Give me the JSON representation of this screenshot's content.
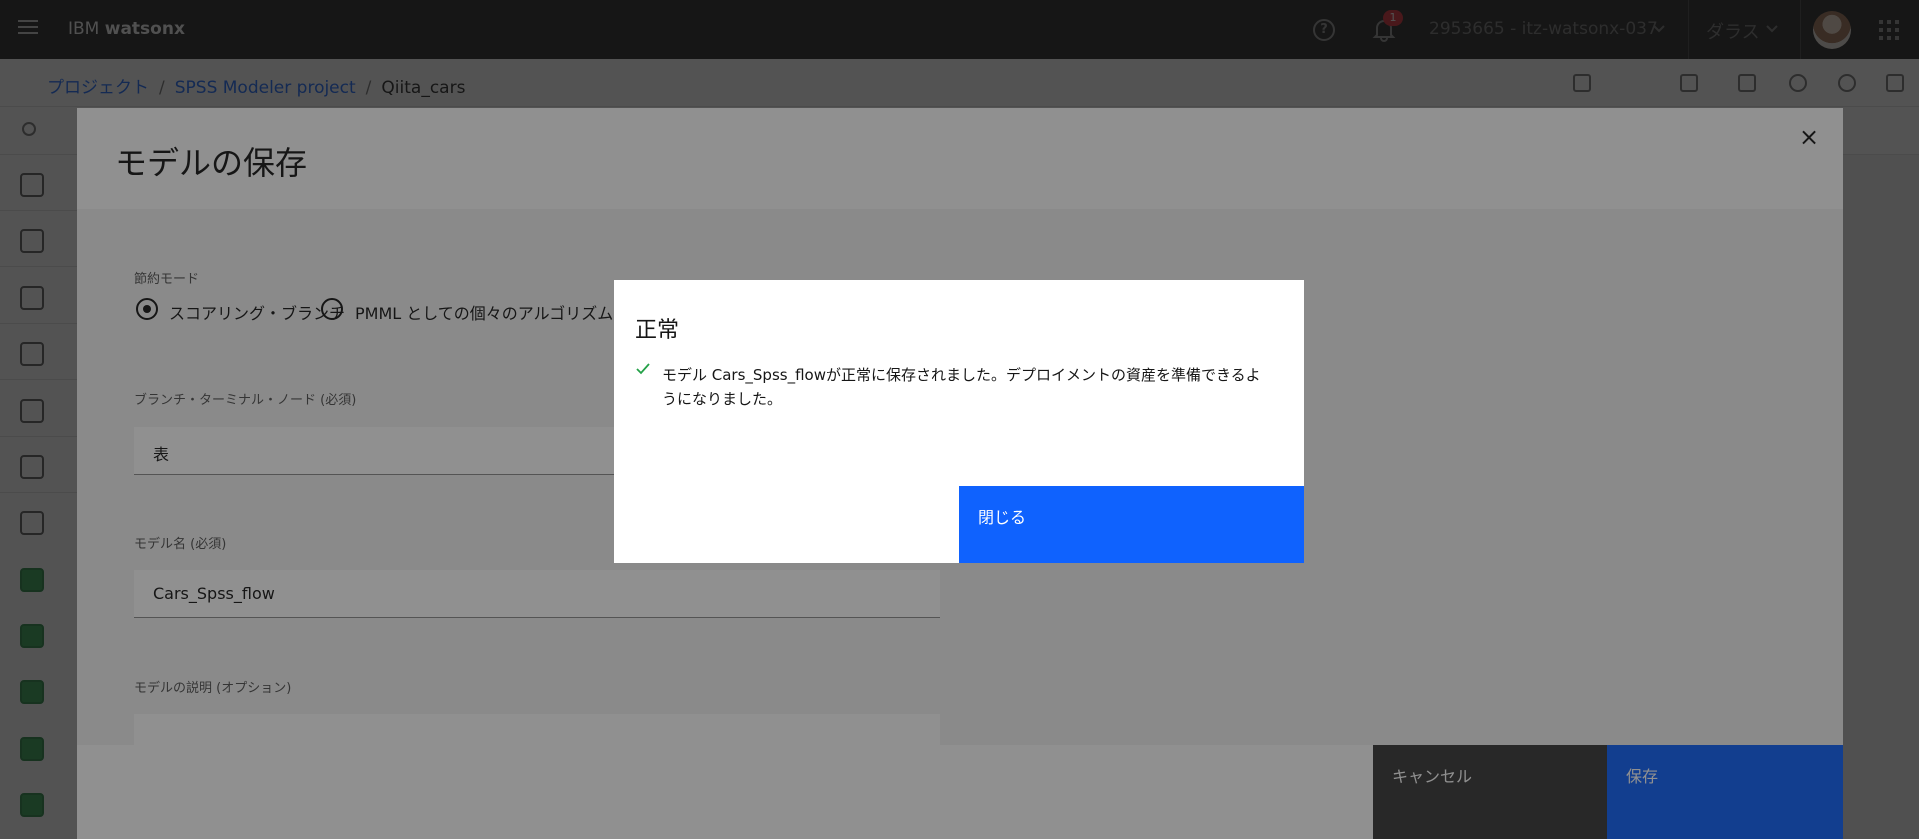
{
  "header": {
    "brand_prefix": "IBM",
    "brand_name": "watsonx",
    "notification_count": "1",
    "account": "2953665 - itz-watsonx-037",
    "region": "ダラス"
  },
  "breadcrumb": {
    "items": [
      "プロジェクト",
      "SPSS Modeler project"
    ],
    "current": "Qiita_cars"
  },
  "save_model_panel": {
    "title": "モデルの保存",
    "close_glyph": "×",
    "save_mode_label": "節約モード",
    "radio_scoring_branch": "スコアリング・ブランチ",
    "radio_pmml": "PMML としての個々のアルゴリズム",
    "branch_terminal_label": "ブランチ・ターミナル・ノード (必須)",
    "branch_terminal_value": "表",
    "model_name_label": "モデル名 (必須)",
    "model_name_value": "Cars_Spss_flow",
    "model_desc_label": "モデルの説明 (オプション)",
    "cancel_label": "キャンセル",
    "save_label": "保存"
  },
  "success_dialog": {
    "title": "正常",
    "message": "モデル Cars_Spss_flowが正常に保存されました。デプロイメントの資産を準備できるようになりました。",
    "close_label": "閉じる"
  },
  "colors": {
    "primary": "#0f62fe",
    "success": "#24a148",
    "header_bg": "#161616"
  }
}
